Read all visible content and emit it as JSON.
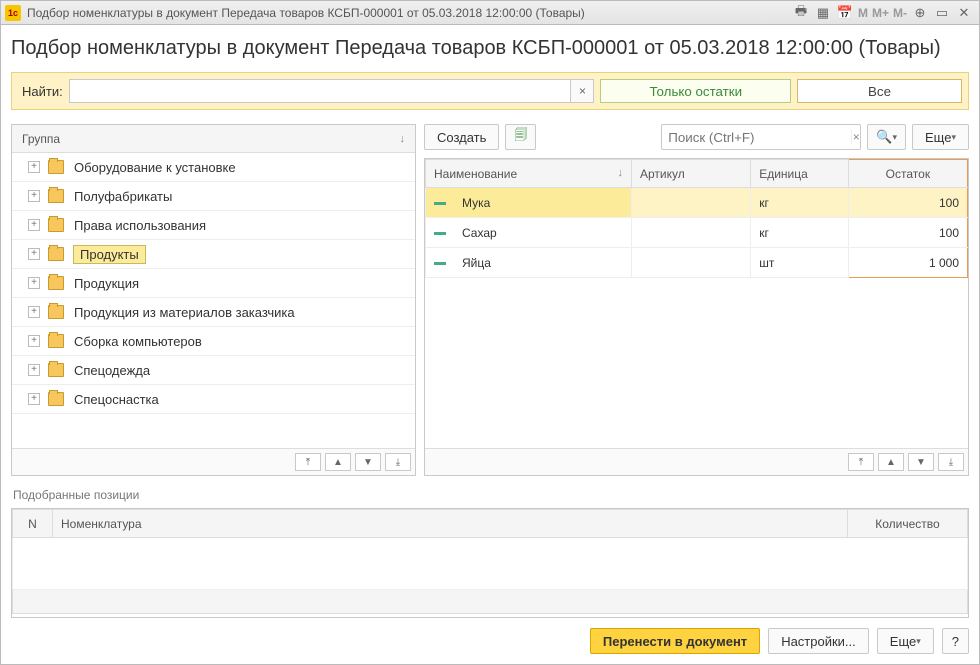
{
  "window_title": "Подбор номенклатуры в документ Передача товаров КСБП-000001 от 05.03.2018 12:00:00 (Товары)",
  "page_title": "Подбор номенклатуры в документ Передача товаров КСБП-000001 от 05.03.2018 12:00:00 (Товары)",
  "title_buttons": {
    "m": "M",
    "mplus": "M+",
    "mminus": "M-"
  },
  "find": {
    "label": "Найти:",
    "value": "",
    "clear": "×",
    "only_balance": "Только остатки",
    "all": "Все"
  },
  "group_panel": {
    "header": "Группа",
    "sort_indicator": "↓"
  },
  "tree": [
    {
      "label": "Оборудование к установке",
      "selected": false
    },
    {
      "label": "Полуфабрикаты",
      "selected": false
    },
    {
      "label": "Права использования",
      "selected": false
    },
    {
      "label": "Продукты",
      "selected": true
    },
    {
      "label": "Продукция",
      "selected": false
    },
    {
      "label": "Продукция из материалов заказчика",
      "selected": false
    },
    {
      "label": "Сборка компьютеров",
      "selected": false
    },
    {
      "label": "Спецодежда",
      "selected": false
    },
    {
      "label": "Спецоснастка",
      "selected": false
    }
  ],
  "right_toolbar": {
    "create": "Создать",
    "search_placeholder": "Поиск (Ctrl+F)",
    "more": "Еще"
  },
  "grid": {
    "columns": {
      "name": "Наименование",
      "article": "Артикул",
      "unit": "Единица",
      "balance": "Остаток"
    },
    "rows": [
      {
        "name": "Мука",
        "article": "",
        "unit": "кг",
        "balance": "100",
        "selected": true
      },
      {
        "name": "Сахар",
        "article": "",
        "unit": "кг",
        "balance": "100",
        "selected": false
      },
      {
        "name": "Яйца",
        "article": "",
        "unit": "шт",
        "balance": "1 000",
        "selected": false
      }
    ]
  },
  "picked": {
    "section_label": "Подобранные позиции",
    "columns": {
      "n": "N",
      "nomenclature": "Номенклатура",
      "qty": "Количество"
    }
  },
  "footer": {
    "transfer": "Перенести в документ",
    "settings": "Настройки...",
    "more": "Еще",
    "help": "?"
  }
}
